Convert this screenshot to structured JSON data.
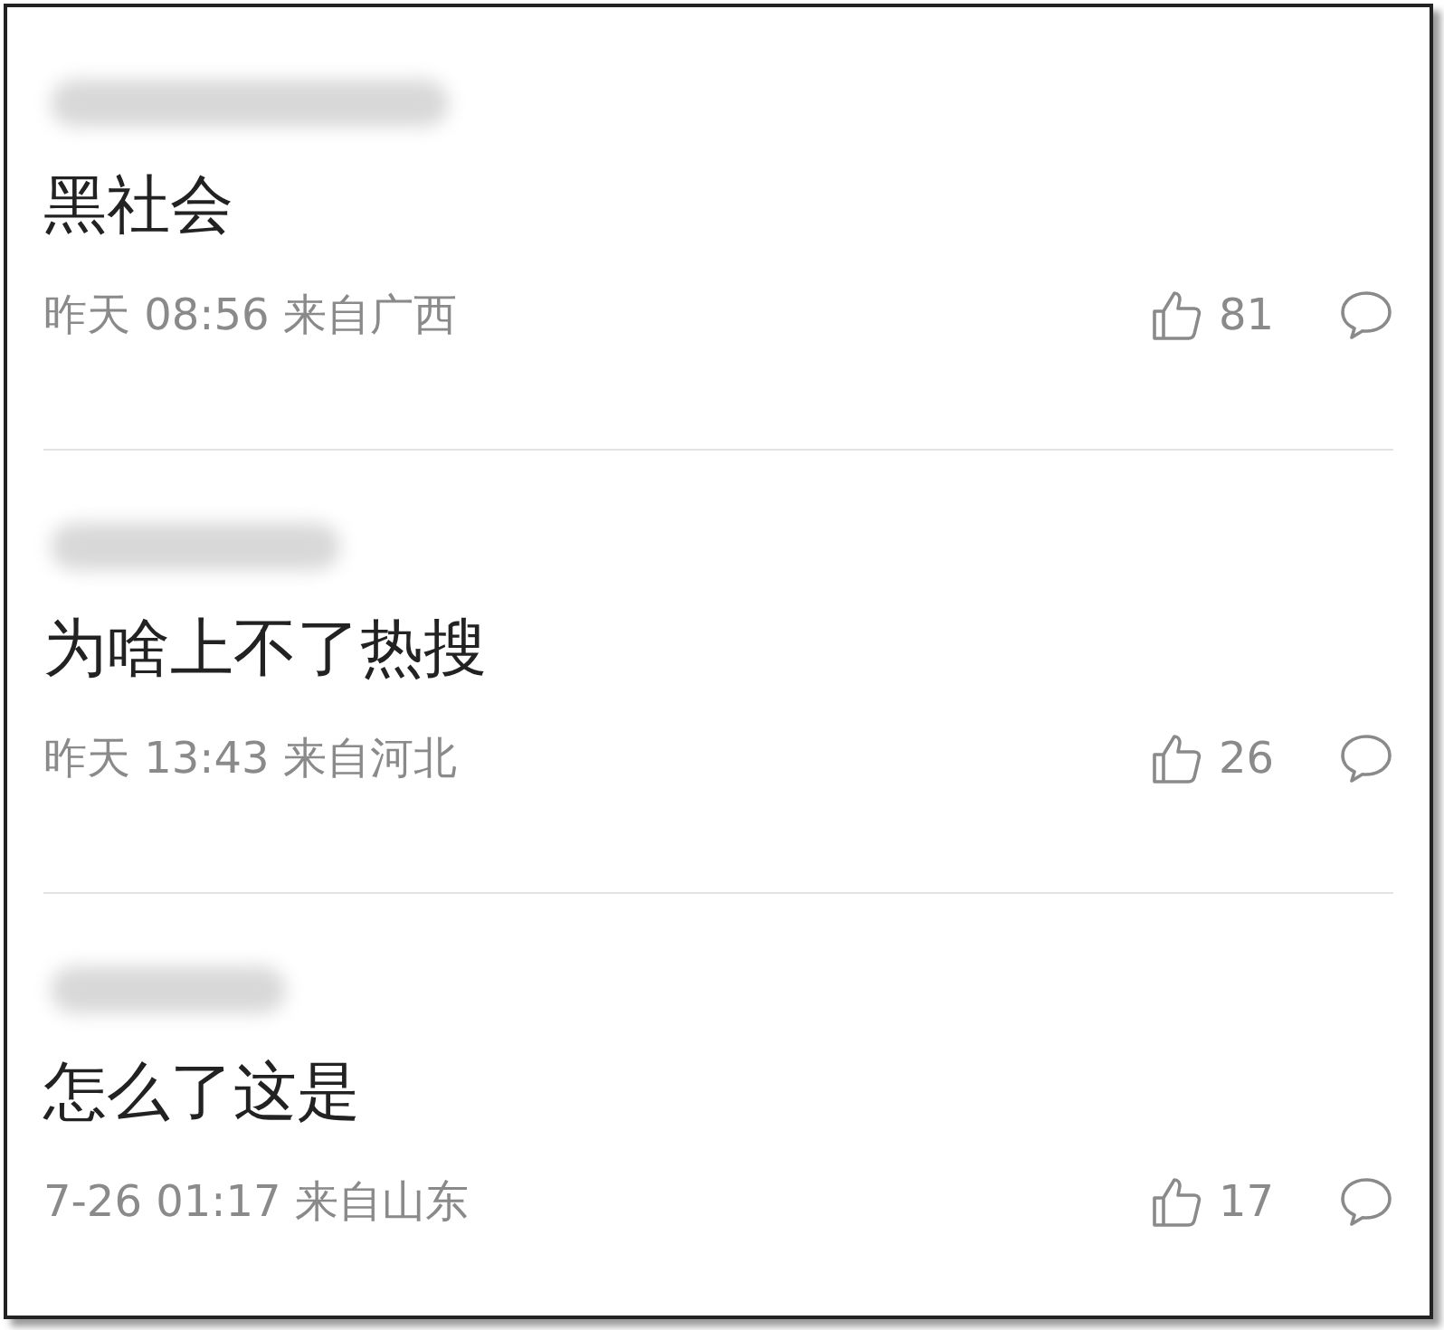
{
  "comments": [
    {
      "text": "黑社会",
      "time": "昨天 08:56 来自广西",
      "likes": "81"
    },
    {
      "text": "为啥上不了热搜",
      "time": "昨天 13:43 来自河北",
      "likes": "26"
    },
    {
      "text": "怎么了这是",
      "time": "7-26 01:17 来自山东",
      "likes": "17"
    }
  ]
}
